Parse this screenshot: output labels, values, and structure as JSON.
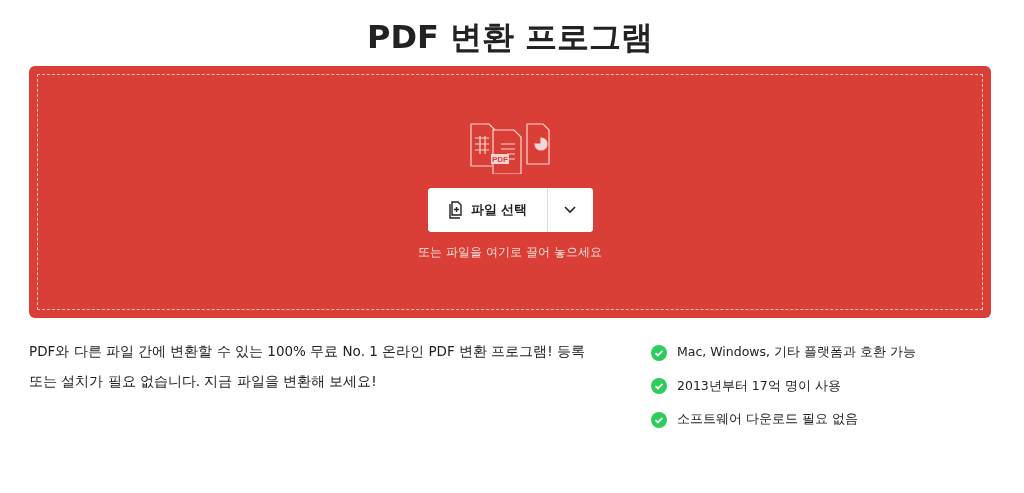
{
  "title": "PDF 변환 프로그램",
  "upload": {
    "icon_label": "PDF",
    "button": "파일 선택",
    "hint": "또는 파일을 여기로 끌어 놓으세요"
  },
  "description": "PDF와 다른 파일 간에 변환할 수 있는 100% 무료 No. 1 온라인 PDF 변환 프로그램! 등록 또는 설치가 필요 없습니다. 지금 파일을 변환해 보세요!",
  "features": [
    {
      "text": "Mac, Windows, 기타 플랫폼과 호환 가능"
    },
    {
      "text": "2013년부터 17억 명이 사용"
    },
    {
      "text": "소프트웨어 다운로드 필요 없음"
    }
  ]
}
